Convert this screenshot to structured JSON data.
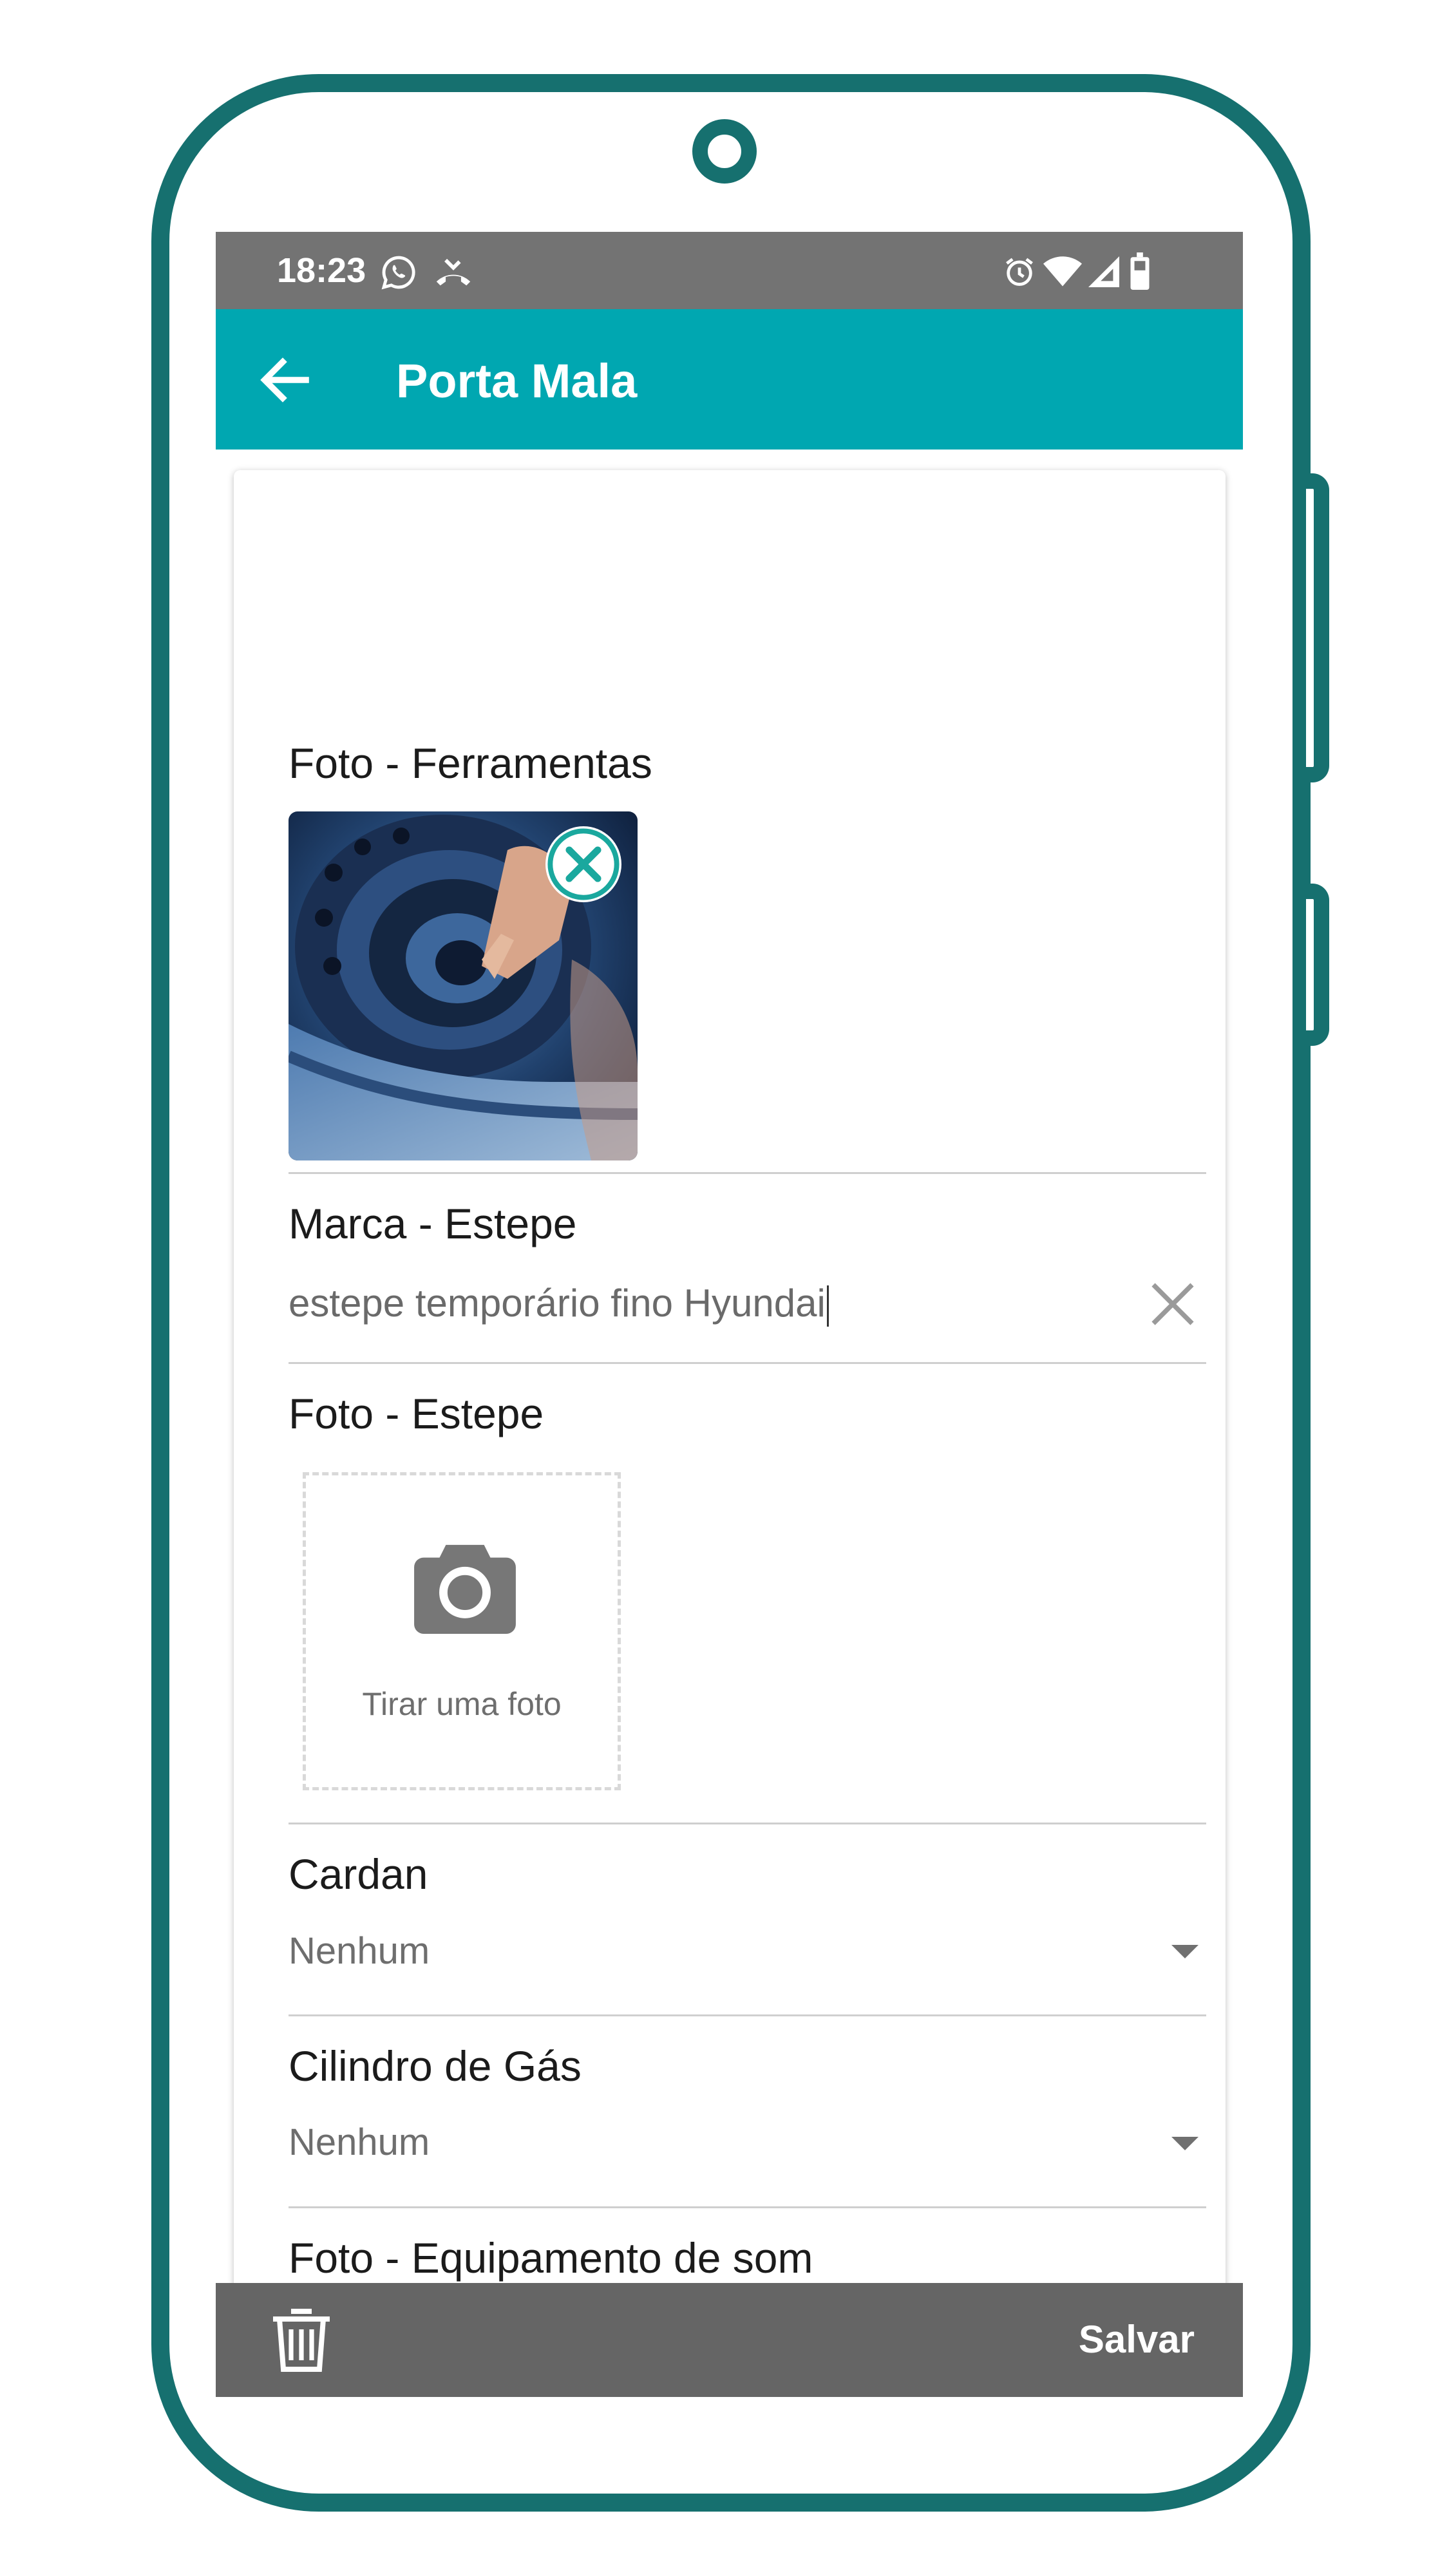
{
  "status_bar": {
    "time": "18:23"
  },
  "header": {
    "title": "Porta Mala"
  },
  "form": {
    "photo_tools": {
      "label": "Foto - Ferramentas"
    },
    "spare_brand": {
      "label": "Marca - Estepe",
      "value": "estepe temporário fino Hyundai"
    },
    "photo_spare": {
      "label": "Foto - Estepe",
      "placeholder": "Tirar uma foto"
    },
    "cardan": {
      "label": "Cardan",
      "value": "Nenhum"
    },
    "gas_cylinder": {
      "label": "Cilindro de Gás",
      "value": "Nenhum"
    },
    "photo_sound": {
      "label": "Foto - Equipamento de som"
    }
  },
  "footer": {
    "save_label": "Salvar"
  },
  "colors": {
    "frame": "#16706f",
    "app_bar": "#00a7b1",
    "status_bar": "#737373",
    "bottom_bar": "#656565"
  },
  "icons": [
    "whatsapp-icon",
    "missed-call-icon",
    "alarm-icon",
    "wifi-icon",
    "signal-icon",
    "battery-icon",
    "back-arrow-icon",
    "close-circle-icon",
    "clear-icon",
    "camera-icon",
    "dropdown-arrow-icon",
    "trash-icon"
  ]
}
